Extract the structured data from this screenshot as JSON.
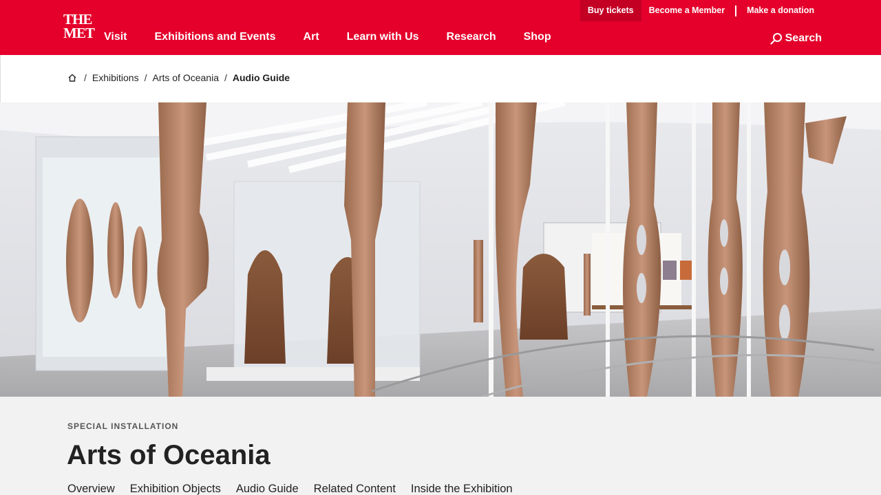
{
  "header": {
    "logo_line1": "THE",
    "logo_line2": "MET",
    "nav": [
      "Visit",
      "Exhibitions and Events",
      "Art",
      "Learn with Us",
      "Research",
      "Shop"
    ],
    "utility": {
      "tickets": "Buy tickets",
      "member": "Become a Member",
      "donate": "Make a donation"
    },
    "search_label": "Search",
    "brand_color": "#e4002b"
  },
  "breadcrumb": {
    "home_icon": "home-icon",
    "items": [
      "Exhibitions",
      "Arts of Oceania"
    ],
    "current": "Audio Guide"
  },
  "hero": {
    "alt": "Gallery view of Arts of Oceania"
  },
  "content": {
    "eyebrow": "SPECIAL INSTALLATION",
    "title": "Arts of Oceania",
    "tabs": [
      "Overview",
      "Exhibition Objects",
      "Audio Guide",
      "Related Content",
      "Inside the Exhibition"
    ]
  }
}
